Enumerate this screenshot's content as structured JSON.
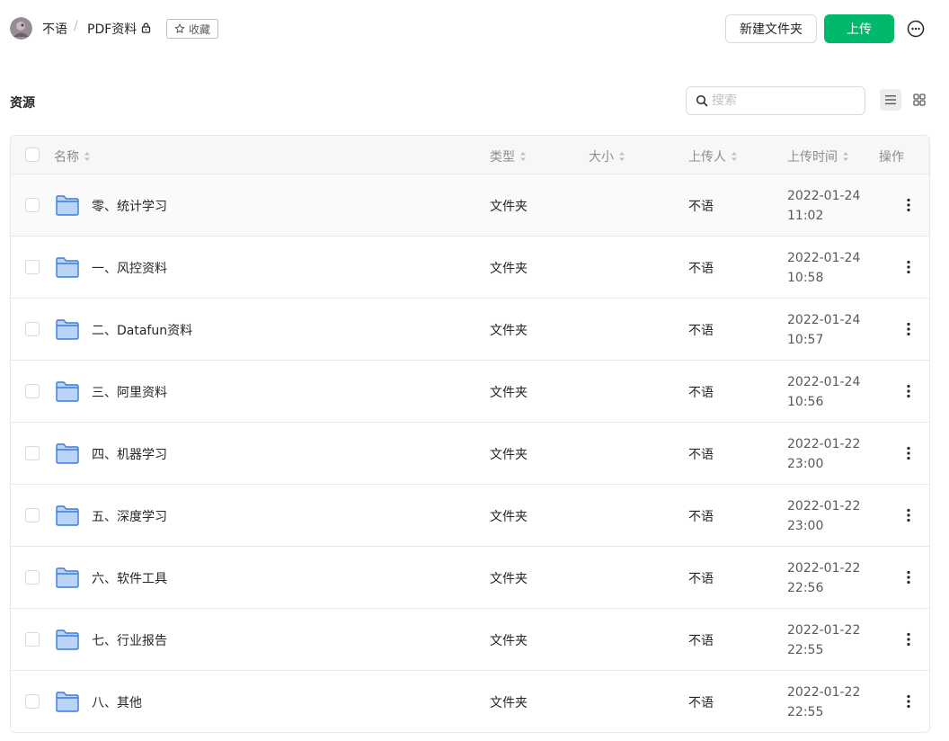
{
  "header": {
    "user_name": "不语",
    "separator": "/",
    "folder_name": "PDF资料",
    "favorite_label": "收藏",
    "new_folder_label": "新建文件夹",
    "upload_label": "上传"
  },
  "section": {
    "title": "资源",
    "search_placeholder": "搜索"
  },
  "table": {
    "columns": {
      "name": "名称",
      "type": "类型",
      "size": "大小",
      "uploader": "上传人",
      "upload_time": "上传时间",
      "actions": "操作"
    },
    "rows": [
      {
        "name": "零、统计学习",
        "type": "文件夹",
        "size": "",
        "uploader": "不语",
        "date": "2022-01-24",
        "time": "11:02"
      },
      {
        "name": "一、风控资料",
        "type": "文件夹",
        "size": "",
        "uploader": "不语",
        "date": "2022-01-24",
        "time": "10:58"
      },
      {
        "name": "二、Datafun资料",
        "type": "文件夹",
        "size": "",
        "uploader": "不语",
        "date": "2022-01-24",
        "time": "10:57"
      },
      {
        "name": "三、阿里资料",
        "type": "文件夹",
        "size": "",
        "uploader": "不语",
        "date": "2022-01-24",
        "time": "10:56"
      },
      {
        "name": "四、机器学习",
        "type": "文件夹",
        "size": "",
        "uploader": "不语",
        "date": "2022-01-22",
        "time": "23:00"
      },
      {
        "name": "五、深度学习",
        "type": "文件夹",
        "size": "",
        "uploader": "不语",
        "date": "2022-01-22",
        "time": "23:00"
      },
      {
        "name": "六、软件工具",
        "type": "文件夹",
        "size": "",
        "uploader": "不语",
        "date": "2022-01-22",
        "time": "22:56"
      },
      {
        "name": "七、行业报告",
        "type": "文件夹",
        "size": "",
        "uploader": "不语",
        "date": "2022-01-22",
        "time": "22:55"
      },
      {
        "name": "八、其他",
        "type": "文件夹",
        "size": "",
        "uploader": "不语",
        "date": "2022-01-22",
        "time": "22:55"
      }
    ]
  },
  "colors": {
    "primary_button": "#00b96b",
    "folder_fill": "#b9d4f7",
    "folder_stroke": "#3b7bd9",
    "hover_row": "#fafafa"
  },
  "icons": {
    "lock": "lock-icon",
    "favorite": "star-icon",
    "more": "more-circle-icon",
    "search": "search-icon",
    "list_view": "list-view-icon",
    "grid_view": "grid-view-icon",
    "sort": "sort-icon",
    "folder": "folder-icon",
    "row_actions": "more-vertical-icon"
  }
}
